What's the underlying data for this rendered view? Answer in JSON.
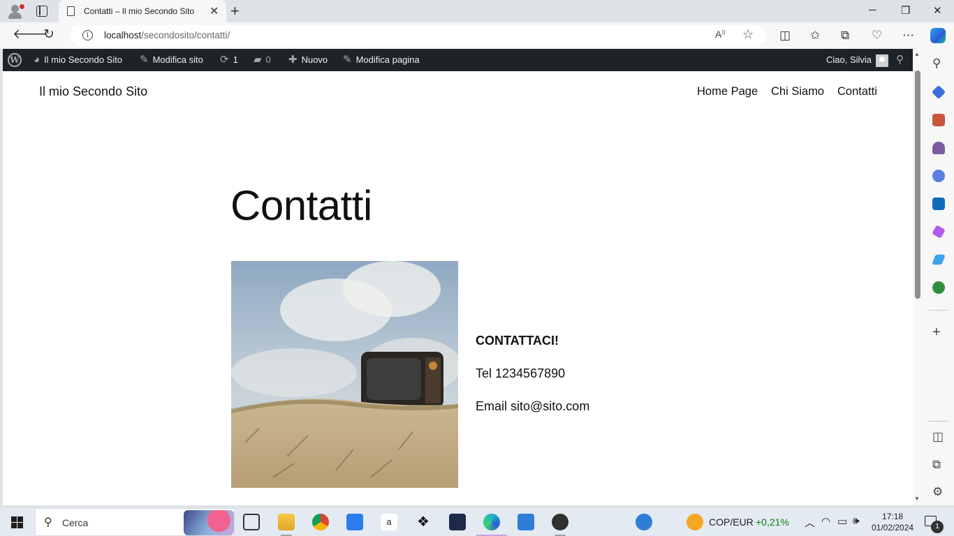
{
  "browser": {
    "tab_title": "Contatti – Il mio Secondo Sito",
    "url_host": "localhost",
    "url_path": "/secondosito/contatti/",
    "new_tab_glyph": "+",
    "tab_close_glyph": "✕",
    "window_controls": [
      "─",
      "❐",
      "✕"
    ]
  },
  "admin_bar": {
    "site_name": "Il mio Secondo Sito",
    "edit_site": "Modifica sito",
    "updates_count": "1",
    "comments_count": "0",
    "new_label": "Nuovo",
    "edit_page": "Modifica pagina",
    "greeting": "Ciao, Silvia"
  },
  "site": {
    "title": "Il mio Secondo Sito",
    "nav": [
      "Home Page",
      "Chi Siamo",
      "Contatti"
    ]
  },
  "page": {
    "heading": "Contatti",
    "contact_title": "CONTATTACI!",
    "phone": "Tel 1234567890",
    "email": "Email sito@sito.com"
  },
  "taskbar": {
    "search_label": "Cerca",
    "amazon_letter": "a",
    "stock_name": "COP/EUR",
    "stock_change": "+0,21%",
    "time": "17:18",
    "date": "01/02/2024",
    "notification_count": "1"
  },
  "colors": {
    "admin_bar_bg": "#1d2327",
    "stock_positive": "#0f7b0f",
    "edge_accent": "#2a5bd7"
  }
}
